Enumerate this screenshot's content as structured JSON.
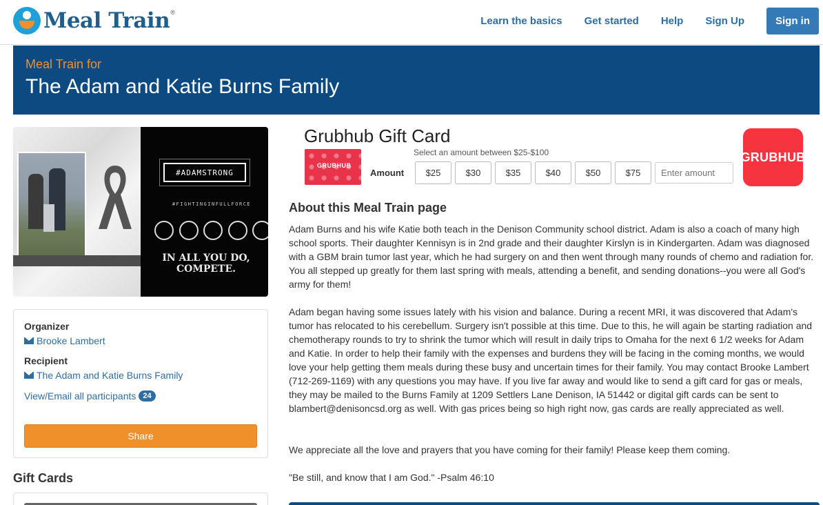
{
  "header": {
    "logo_text": "Meal Train",
    "logo_reg": "®",
    "nav": {
      "learn": "Learn the basics",
      "start": "Get started",
      "help": "Help",
      "signup": "Sign Up",
      "signin": "Sign in"
    }
  },
  "banner": {
    "pre": "Meal Train for",
    "title": "The Adam and Katie Burns Family"
  },
  "hero": {
    "tag": "#ADAMSTRONG",
    "sub": "#FIGHTINGINFULLFORCE",
    "motto": "IN ALL YOU DO, COMPETE."
  },
  "sidebar": {
    "organizer_label": "Organizer",
    "organizer_name": "Brooke Lambert",
    "recipient_label": "Recipient",
    "recipient_name": "The Adam and Katie Burns Family",
    "participants_link": "View/Email all participants",
    "participants_count": "24",
    "share_label": "Share",
    "gift_cards_heading": "Gift Cards"
  },
  "giftcard": {
    "title": "Grubhub Gift Card",
    "card_text": "GRUBHUB",
    "hint": "Select an amount between $25-$100",
    "amount_label": "Amount",
    "amounts": [
      "$25",
      "$30",
      "$35",
      "$40",
      "$50",
      "$75"
    ],
    "input_placeholder": "Enter amount",
    "logo_text": "GRUBHUB"
  },
  "about": {
    "heading": "About this Meal Train page",
    "p1": "Adam Burns and his wife Katie both teach in the Denison Community school district.  Adam is also a coach of many high school sports. Their daughter Kennisyn is in 2nd grade and their daughter Kirslyn is in Kindergarten.  Adam was diagnosed with a GBM brain tumor last year, which he had surgery on and then went through many rounds of chemo and radiation for.  You all stepped up greatly for them last spring with meals, attending a benefit, and sending donations--you were all God's army for them!",
    "p2": "Adam began having some issues lately with his vision and balance. During a recent MRI, it was discovered that Adam's tumor has relocated to his cerebellum. Surgery isn't possible at this time. Due to this, he will again be starting radiation and chemotherapy rounds to try to shrink the tumor which will result in daily trips to Omaha for the next 6 1/2 weeks for Adam and Katie. In order to help their family with the expenses and burdens they will be facing in the coming months, we would love your help getting them meals during these busy and uncertain times for their family. You may contact Brooke Lambert (712-269-1169) with any questions you may have.  If you live far away and would like to send a gift card for gas or meals, they may be mailed to the Burns Family at 1209 Settlers Lane Denison, IA 51442 or digital gift cards can be sent to blambert@denisoncsd.org as well. With gas prices being so high right now, gas cards are really appreciated as well.",
    "p3": "We appreciate all the love and prayers that you have coming for their family! Please keep them coming.",
    "p4": "\"Be still, and know that I am God.\" -Psalm 46:10"
  },
  "colors": {
    "brand_blue": "#0e4a82",
    "link_blue": "#2e6da4",
    "accent_orange": "#f0902a",
    "grubhub_red": "#f63440"
  }
}
